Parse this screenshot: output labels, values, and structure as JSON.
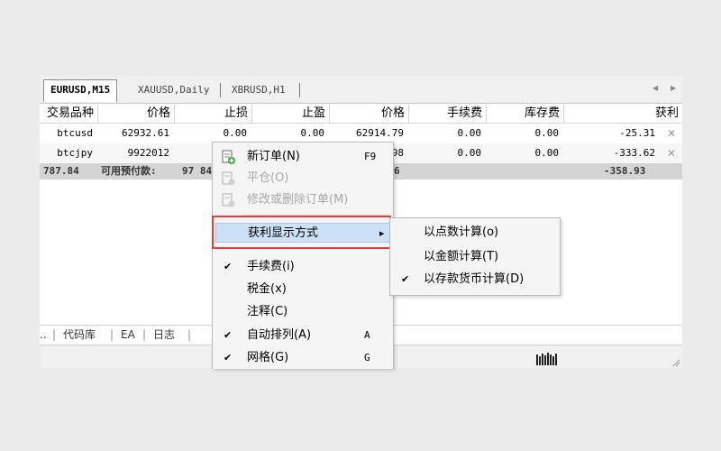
{
  "chart_tabs": [
    "EURUSD,M15",
    "XAUUSD,Daily",
    "XBRUSD,H1"
  ],
  "nav_arrows": {
    "left": "◀",
    "right": "▶"
  },
  "table": {
    "headers": [
      "交易品种",
      "价格",
      "止损",
      "止盈",
      "价格",
      "手续费",
      "库存费",
      "获利"
    ],
    "rows": [
      {
        "symbol": "btcusd",
        "open_price": "62932.61",
        "sl": "0.00",
        "tp": "0.00",
        "price": "62914.79",
        "commission": "0.00",
        "swap": "0.00",
        "profit": "-25.31"
      },
      {
        "symbol": "btcjpy",
        "open_price": "9922012",
        "sl": "",
        "tp": "",
        "price": "98",
        "commission": "0.00",
        "swap": "0.00",
        "profit": "-333.62"
      }
    ],
    "balance": {
      "left_value": "787.84",
      "free_margin_label": "可用预付款:",
      "free_margin_value": "97 84",
      "mid_value": "6",
      "total_profit": "-358.93"
    }
  },
  "bottom_tabs": [
    "..",
    "代码库",
    "EA",
    "日志"
  ],
  "context_menu": {
    "items": [
      {
        "label": "新订单(N)",
        "shortcut": "F9",
        "icon": "new-order-icon",
        "disabled": false
      },
      {
        "label": "平仓(O)",
        "icon": "close-position-icon",
        "disabled": true
      },
      {
        "label": "修改或删除订单(M)",
        "icon": "modify-order-icon",
        "disabled": true
      },
      {
        "label": "获利显示方式",
        "has_submenu": true,
        "highlighted": true
      },
      {
        "label": "手续费(i)",
        "checked": true
      },
      {
        "label": "税金(x)",
        "checked": false
      },
      {
        "label": "注释(C)",
        "checked": false
      },
      {
        "label": "自动排列(A)",
        "shortcut": "A",
        "checked": true
      },
      {
        "label": "网格(G)",
        "shortcut": "G",
        "checked": true
      }
    ],
    "check_mark": "✔",
    "submenu_arrow": "▶"
  },
  "submenu": {
    "items": [
      {
        "label": "以点数计算(o)",
        "checked": false
      },
      {
        "label": "以金额计算(T)",
        "checked": false
      },
      {
        "label": "以存款货币计算(D)",
        "checked": true
      }
    ]
  },
  "colors": {
    "highlight_border": "#e43d3d",
    "menu_highlight": "#cce0f6"
  }
}
